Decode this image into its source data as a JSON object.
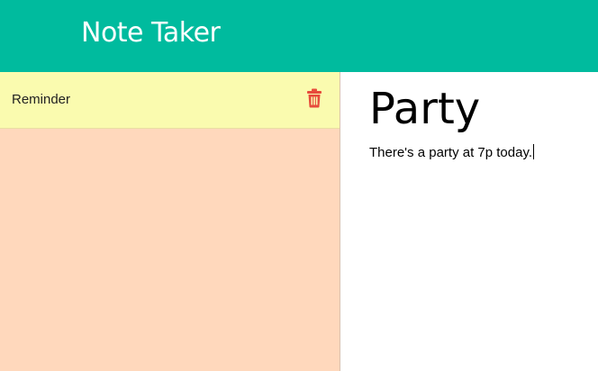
{
  "navbar": {
    "brand": "Note Taker"
  },
  "sidebar": {
    "notes": [
      {
        "title": "Reminder",
        "delete_icon": "trash-icon"
      }
    ]
  },
  "editor": {
    "title": "Party",
    "text": "There's a party at 7p today."
  },
  "colors": {
    "navbar_bg": "#00bb9e",
    "sidebar_bg": "#ffd8bc",
    "selected_note_bg": "#fafbaf",
    "delete_icon": "#e74c3c"
  }
}
